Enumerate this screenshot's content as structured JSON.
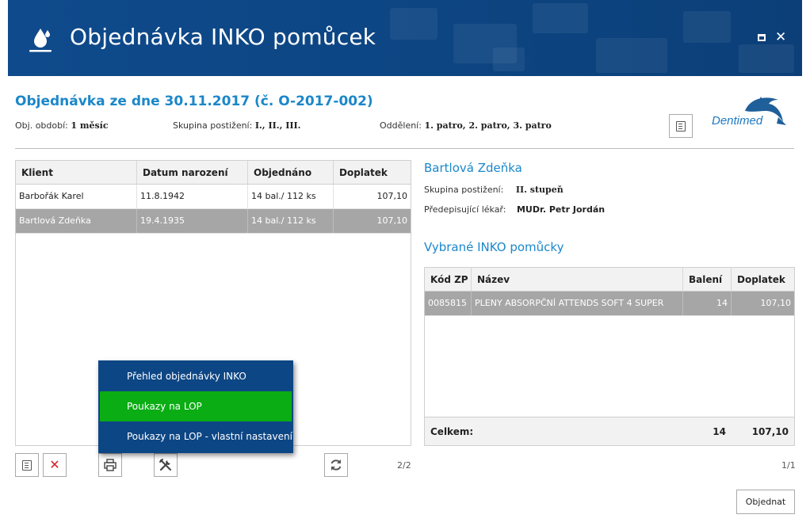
{
  "window": {
    "title": "Objednávka INKO pomůcek",
    "accent_color": "#0f4a8c",
    "link_color": "#1b87c9",
    "icons": [
      "drop-icon",
      "maximize-icon",
      "close-icon"
    ]
  },
  "order": {
    "title": "Objednávka ze dne 30.11.2017 (č. O-2017-002)",
    "obdobi_label": "Obj. období:",
    "obdobi_value": "1 měsíc",
    "skupina_label": "Skupina postižení:",
    "skupina_value": "I., II., III.",
    "oddeleni_label": "Oddělení:",
    "oddeleni_value": "1. patro, 2. patro, 3. patro"
  },
  "logo": {
    "text": "Dentimed"
  },
  "clients_table": {
    "columns": [
      "Klient",
      "Datum narození",
      "Objednáno",
      "Doplatek"
    ],
    "rows": [
      {
        "klient": "Barbořák Karel",
        "datum": "11.8.1942",
        "objednano": "14 bal./ 112 ks",
        "doplatek": "107,10",
        "selected": false
      },
      {
        "klient": "Bartlová Zdeňka",
        "datum": "19.4.1935",
        "objednano": "14 bal./ 112 ks",
        "doplatek": "107,10",
        "selected": true
      }
    ],
    "pager": "2/2"
  },
  "client_detail": {
    "name": "Bartlová Zdeňka",
    "skupina_label": "Skupina postižení:",
    "skupina_value": "II. stupeň",
    "lekar_label": "Předepisující lékař:",
    "lekar_value": "MUDr. Petr Jordán"
  },
  "items": {
    "title": "Vybrané INKO pomůcky",
    "columns": [
      "Kód ZP",
      "Název",
      "Balení",
      "Doplatek"
    ],
    "rows": [
      {
        "kod": "0085815",
        "nazev": "PLENY ABSORPČNÍ ATTENDS SOFT 4 SUPER",
        "baleni": "14",
        "doplatek": "107,10",
        "selected": true
      }
    ],
    "footer": {
      "label": "Celkem:",
      "baleni": "14",
      "doplatek": "107,10"
    },
    "pager": "1/1"
  },
  "toolbar": {
    "icons": [
      "document-icon",
      "delete-icon",
      "print-icon",
      "tools-icon",
      "refresh-icon"
    ]
  },
  "print_menu": {
    "items": [
      {
        "label": "Přehled objednávky INKO",
        "active": false
      },
      {
        "label": "Poukazy na LOP",
        "active": true
      },
      {
        "label": "Poukazy na LOP - vlastní nastavení",
        "active": false
      }
    ],
    "active_color": "#0aad14"
  },
  "buttons": {
    "order_label": "Objednat"
  }
}
